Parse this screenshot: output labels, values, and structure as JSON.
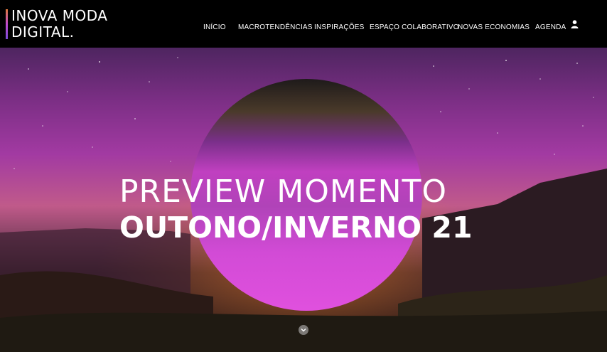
{
  "logo": {
    "line1": "INOVA MODA",
    "line2": "DIGITAL."
  },
  "nav": {
    "items": [
      {
        "label": "INÍCIO"
      },
      {
        "label": "MACROTENDÊNCIAS"
      },
      {
        "label": "INSPIRAÇÕES"
      },
      {
        "label": "ESPAÇO COLABORATIVO"
      },
      {
        "label": "NOVAS ECONOMIAS"
      },
      {
        "label": "AGENDA"
      }
    ],
    "user_icon": "user-icon"
  },
  "hero": {
    "title_line1": "PREVIEW MOMENTO",
    "title_line2": "OUTONO/INVERNO 21",
    "scroll_icon": "chevron-down-icon"
  },
  "colors": {
    "header_bg": "#000000",
    "accent_purple": "#c040c0",
    "accent_orange": "#e07a3c"
  }
}
